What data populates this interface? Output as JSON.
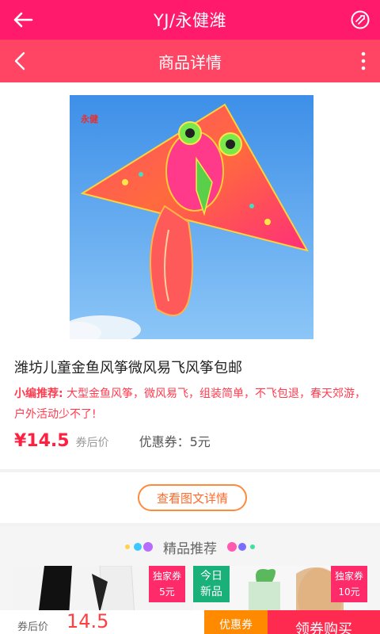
{
  "header": {
    "title": "YJ/永健潍"
  },
  "nav": {
    "title": "商品详情"
  },
  "product": {
    "brand": "永健",
    "title": "潍坊儿童金鱼风筝微风易飞风筝包邮",
    "rec_label": "小编推荐:",
    "rec_text": "大型金鱼风筝，微风易飞，组装简单，不飞包退，春天郊游，户外活动少不了!",
    "price": "¥14.5",
    "price_note": "券后价",
    "coupon": "优惠券：5元"
  },
  "detail_button": "查看图文详情",
  "recommend": {
    "title": "精品推荐",
    "tiles": [
      {
        "badge_line1": "独家券",
        "badge_line2": "5元"
      },
      {
        "badge_line1": "今日",
        "badge_line2": "新品"
      },
      {
        "badge_line1": "独家券",
        "badge_line2": "10元"
      }
    ]
  },
  "bottom": {
    "cut_label": "券后价",
    "cut_price": "14.5",
    "coupon_button": "优惠券",
    "buy_button": "领券购买"
  },
  "colors": {
    "header": "#ff1a6c",
    "nav": "#ff4563",
    "price": "#ff2040"
  }
}
